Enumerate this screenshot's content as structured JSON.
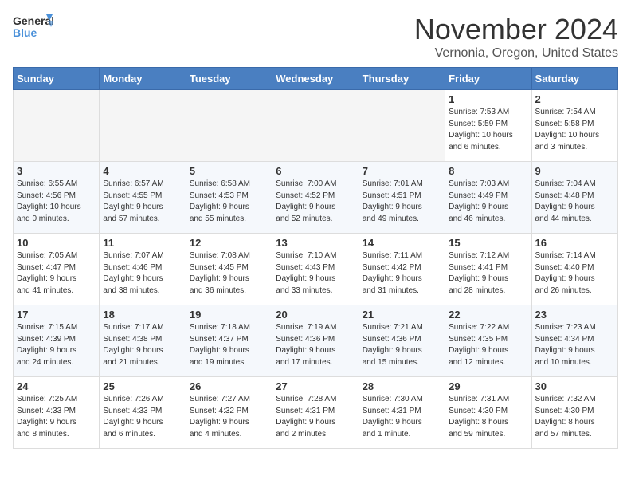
{
  "header": {
    "logo_general": "General",
    "logo_blue": "Blue",
    "month_title": "November 2024",
    "location": "Vernonia, Oregon, United States"
  },
  "weekdays": [
    "Sunday",
    "Monday",
    "Tuesday",
    "Wednesday",
    "Thursday",
    "Friday",
    "Saturday"
  ],
  "weeks": [
    [
      {
        "day": "",
        "info": ""
      },
      {
        "day": "",
        "info": ""
      },
      {
        "day": "",
        "info": ""
      },
      {
        "day": "",
        "info": ""
      },
      {
        "day": "",
        "info": ""
      },
      {
        "day": "1",
        "info": "Sunrise: 7:53 AM\nSunset: 5:59 PM\nDaylight: 10 hours\nand 6 minutes."
      },
      {
        "day": "2",
        "info": "Sunrise: 7:54 AM\nSunset: 5:58 PM\nDaylight: 10 hours\nand 3 minutes."
      }
    ],
    [
      {
        "day": "3",
        "info": "Sunrise: 6:55 AM\nSunset: 4:56 PM\nDaylight: 10 hours\nand 0 minutes."
      },
      {
        "day": "4",
        "info": "Sunrise: 6:57 AM\nSunset: 4:55 PM\nDaylight: 9 hours\nand 57 minutes."
      },
      {
        "day": "5",
        "info": "Sunrise: 6:58 AM\nSunset: 4:53 PM\nDaylight: 9 hours\nand 55 minutes."
      },
      {
        "day": "6",
        "info": "Sunrise: 7:00 AM\nSunset: 4:52 PM\nDaylight: 9 hours\nand 52 minutes."
      },
      {
        "day": "7",
        "info": "Sunrise: 7:01 AM\nSunset: 4:51 PM\nDaylight: 9 hours\nand 49 minutes."
      },
      {
        "day": "8",
        "info": "Sunrise: 7:03 AM\nSunset: 4:49 PM\nDaylight: 9 hours\nand 46 minutes."
      },
      {
        "day": "9",
        "info": "Sunrise: 7:04 AM\nSunset: 4:48 PM\nDaylight: 9 hours\nand 44 minutes."
      }
    ],
    [
      {
        "day": "10",
        "info": "Sunrise: 7:05 AM\nSunset: 4:47 PM\nDaylight: 9 hours\nand 41 minutes."
      },
      {
        "day": "11",
        "info": "Sunrise: 7:07 AM\nSunset: 4:46 PM\nDaylight: 9 hours\nand 38 minutes."
      },
      {
        "day": "12",
        "info": "Sunrise: 7:08 AM\nSunset: 4:45 PM\nDaylight: 9 hours\nand 36 minutes."
      },
      {
        "day": "13",
        "info": "Sunrise: 7:10 AM\nSunset: 4:43 PM\nDaylight: 9 hours\nand 33 minutes."
      },
      {
        "day": "14",
        "info": "Sunrise: 7:11 AM\nSunset: 4:42 PM\nDaylight: 9 hours\nand 31 minutes."
      },
      {
        "day": "15",
        "info": "Sunrise: 7:12 AM\nSunset: 4:41 PM\nDaylight: 9 hours\nand 28 minutes."
      },
      {
        "day": "16",
        "info": "Sunrise: 7:14 AM\nSunset: 4:40 PM\nDaylight: 9 hours\nand 26 minutes."
      }
    ],
    [
      {
        "day": "17",
        "info": "Sunrise: 7:15 AM\nSunset: 4:39 PM\nDaylight: 9 hours\nand 24 minutes."
      },
      {
        "day": "18",
        "info": "Sunrise: 7:17 AM\nSunset: 4:38 PM\nDaylight: 9 hours\nand 21 minutes."
      },
      {
        "day": "19",
        "info": "Sunrise: 7:18 AM\nSunset: 4:37 PM\nDaylight: 9 hours\nand 19 minutes."
      },
      {
        "day": "20",
        "info": "Sunrise: 7:19 AM\nSunset: 4:36 PM\nDaylight: 9 hours\nand 17 minutes."
      },
      {
        "day": "21",
        "info": "Sunrise: 7:21 AM\nSunset: 4:36 PM\nDaylight: 9 hours\nand 15 minutes."
      },
      {
        "day": "22",
        "info": "Sunrise: 7:22 AM\nSunset: 4:35 PM\nDaylight: 9 hours\nand 12 minutes."
      },
      {
        "day": "23",
        "info": "Sunrise: 7:23 AM\nSunset: 4:34 PM\nDaylight: 9 hours\nand 10 minutes."
      }
    ],
    [
      {
        "day": "24",
        "info": "Sunrise: 7:25 AM\nSunset: 4:33 PM\nDaylight: 9 hours\nand 8 minutes."
      },
      {
        "day": "25",
        "info": "Sunrise: 7:26 AM\nSunset: 4:33 PM\nDaylight: 9 hours\nand 6 minutes."
      },
      {
        "day": "26",
        "info": "Sunrise: 7:27 AM\nSunset: 4:32 PM\nDaylight: 9 hours\nand 4 minutes."
      },
      {
        "day": "27",
        "info": "Sunrise: 7:28 AM\nSunset: 4:31 PM\nDaylight: 9 hours\nand 2 minutes."
      },
      {
        "day": "28",
        "info": "Sunrise: 7:30 AM\nSunset: 4:31 PM\nDaylight: 9 hours\nand 1 minute."
      },
      {
        "day": "29",
        "info": "Sunrise: 7:31 AM\nSunset: 4:30 PM\nDaylight: 8 hours\nand 59 minutes."
      },
      {
        "day": "30",
        "info": "Sunrise: 7:32 AM\nSunset: 4:30 PM\nDaylight: 8 hours\nand 57 minutes."
      }
    ]
  ]
}
